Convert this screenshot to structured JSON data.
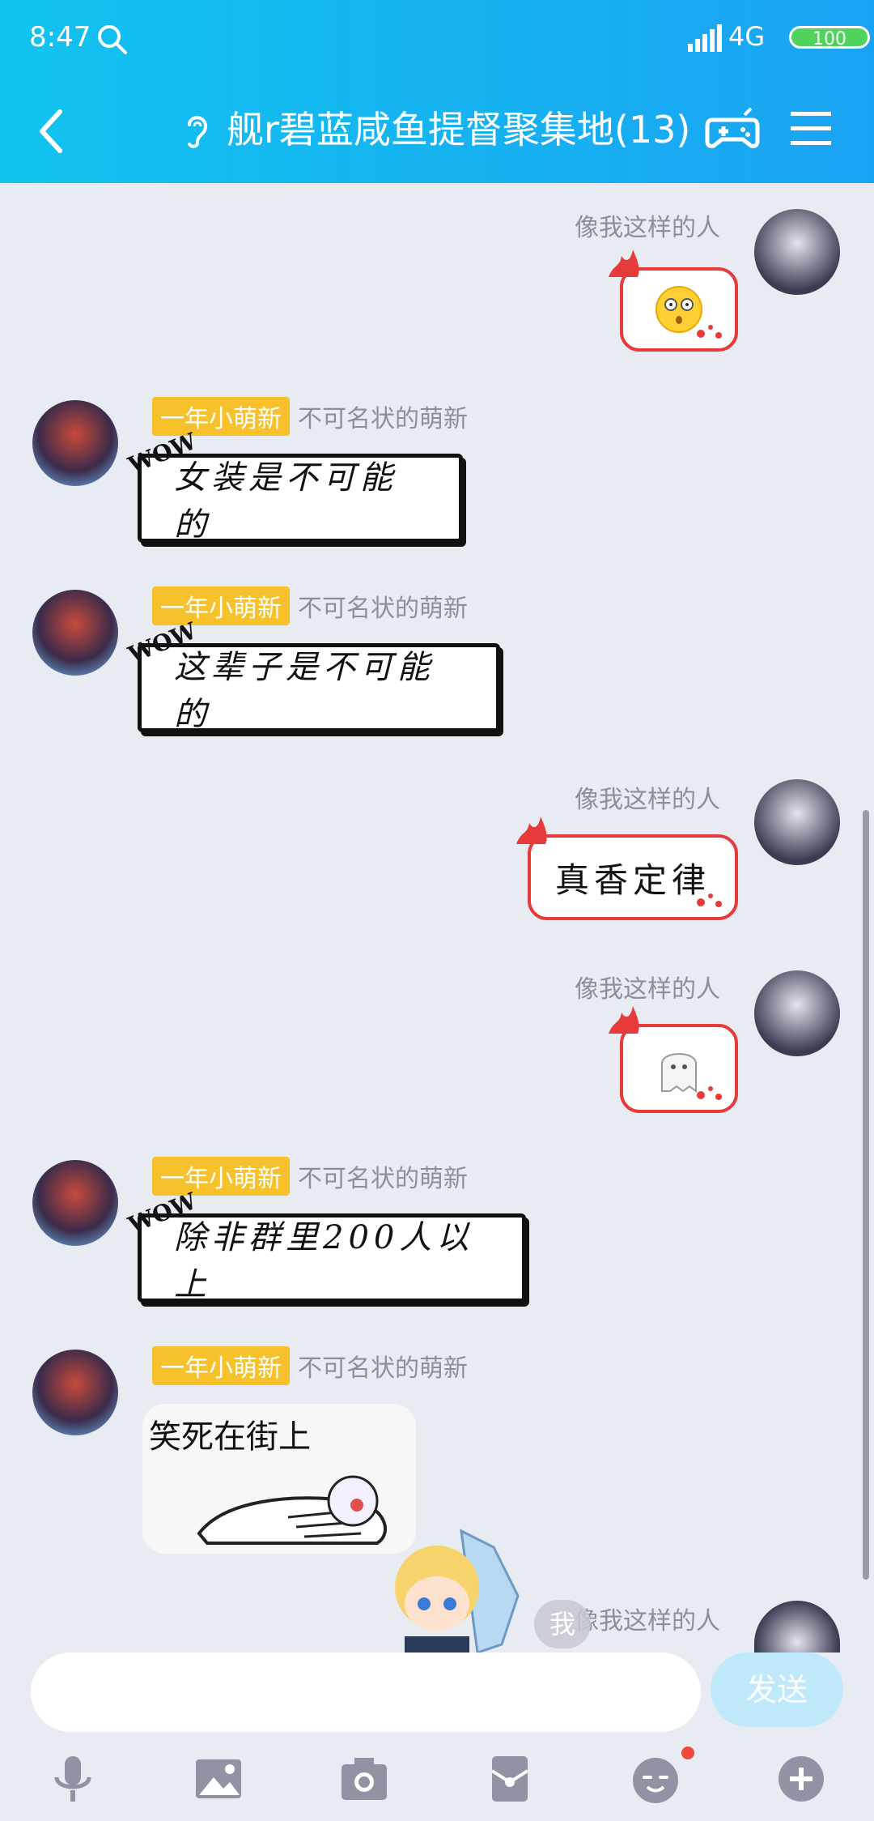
{
  "status": {
    "time": "8:47",
    "network": "4G",
    "battery": "100"
  },
  "header": {
    "title": "舰r碧蓝咸鱼提督聚集地(13)"
  },
  "messages": [
    {
      "side": "right",
      "sender": "像我这样的人",
      "type": "emoji",
      "emoji": "dizzy-face"
    },
    {
      "side": "left",
      "badge": "一年小萌新",
      "sender": "不可名状的萌新",
      "type": "wow",
      "wow_tag": "WOW",
      "text": "女装是不可能的"
    },
    {
      "side": "left",
      "badge": "一年小萌新",
      "sender": "不可名状的萌新",
      "type": "wow",
      "wow_tag": "WOW",
      "text": "这辈子是不可能的"
    },
    {
      "side": "right",
      "sender": "像我这样的人",
      "type": "text",
      "text": "真香定律"
    },
    {
      "side": "right",
      "sender": "像我这样的人",
      "type": "emoji",
      "emoji": "ghost"
    },
    {
      "side": "left",
      "badge": "一年小萌新",
      "sender": "不可名状的萌新",
      "type": "wow",
      "wow_tag": "WOW",
      "text": "除非群里200人以上"
    },
    {
      "side": "left",
      "badge": "一年小萌新",
      "sender": "不可名状的萌新",
      "type": "image",
      "caption": "笑死在街上"
    },
    {
      "side": "right",
      "sender": "像我这样的人"
    }
  ],
  "me_label": "我",
  "composer": {
    "placeholder": "",
    "send_label": "发送"
  },
  "toolbar": [
    "microphone-icon",
    "image-icon",
    "camera-icon",
    "red-packet-icon",
    "emoji-icon",
    "plus-icon"
  ]
}
